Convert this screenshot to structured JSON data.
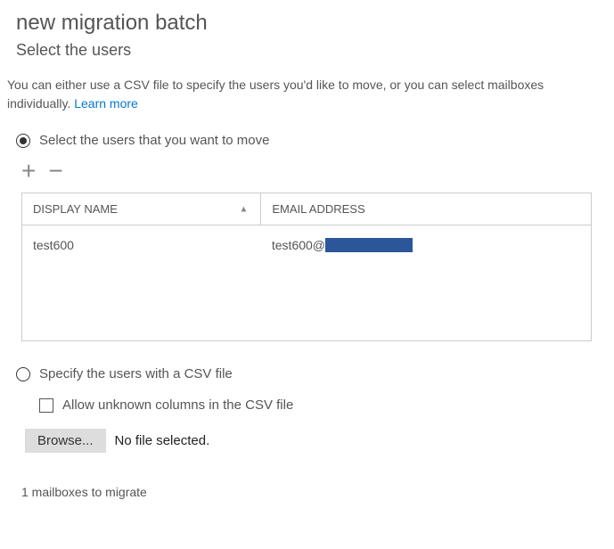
{
  "page": {
    "title": "new migration batch",
    "subtitle": "Select the users"
  },
  "intro": {
    "text": "You can either use a CSV file to specify the users you'd like to move, or you can select mailboxes individually. ",
    "link": "Learn more"
  },
  "options": {
    "select_users_label": "Select the users that you want to move",
    "csv_label": "Specify the users with a CSV file"
  },
  "table": {
    "col_name": "DISPLAY NAME",
    "col_email": "EMAIL ADDRESS",
    "rows": [
      {
        "name": "test600",
        "email_prefix": "test600@"
      }
    ]
  },
  "checkbox": {
    "allow_unknown_label": "Allow unknown columns in the CSV file"
  },
  "browse": {
    "button_label": "Browse...",
    "status": "No file selected."
  },
  "summary": "1 mailboxes to migrate"
}
